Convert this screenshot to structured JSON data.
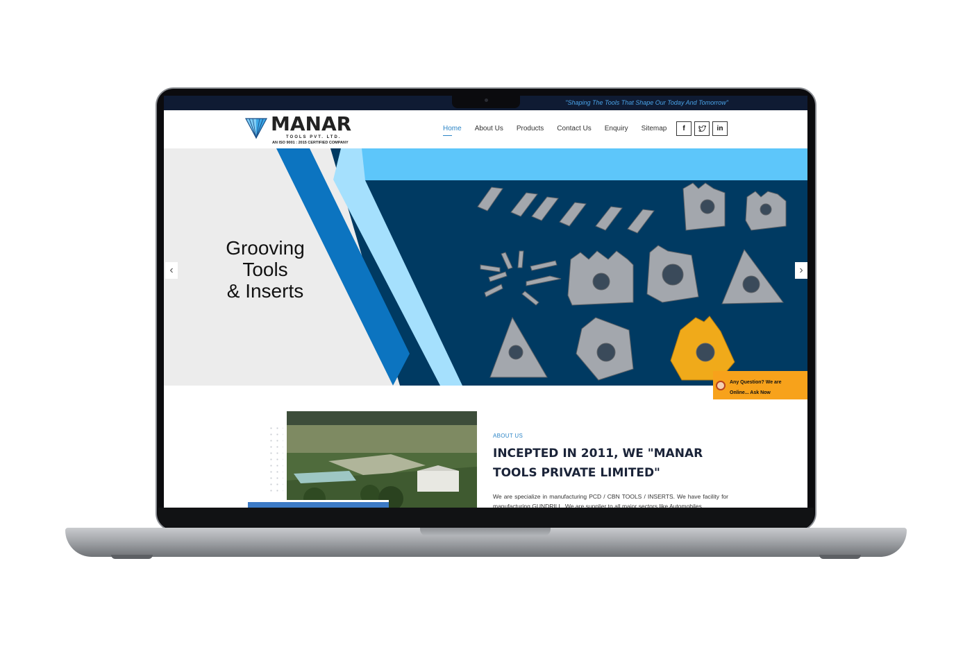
{
  "topbar": {
    "tagline": "\"Shaping The Tools That Shape Our Today And Tomorrow\""
  },
  "logo": {
    "name": "MANAR",
    "subtitle": "TOOLS PVT. LTD.",
    "certification": "AN ISO 9001 : 2015 CERTIFIED COMPANY"
  },
  "nav": {
    "items": [
      {
        "label": "Home",
        "active": true
      },
      {
        "label": "About Us"
      },
      {
        "label": "Products"
      },
      {
        "label": "Contact Us"
      },
      {
        "label": "Enquiry"
      },
      {
        "label": "Sitemap"
      }
    ]
  },
  "social": {
    "facebook": "f",
    "twitter": "t",
    "linkedin": "in"
  },
  "hero": {
    "title_lines": [
      "Grooving",
      "Tools",
      "& Inserts"
    ],
    "prev": "‹",
    "next": "›"
  },
  "chat": {
    "line1": "Any Question? We are",
    "line2": "Online... Ask Now"
  },
  "about": {
    "kicker": "ABOUT US",
    "heading": "INCEPTED IN 2011, WE \"MANAR TOOLS PRIVATE LIMITED\"",
    "text": "We are specialize in manufacturing PCD / CBN TOOLS / INSERTS. We have facility for manufacturing GUNDRILL. We are supplier to all major sectors like Automobiles,"
  },
  "colors": {
    "accent": "#2b84c6",
    "navy": "#0f1b33",
    "hero_dark": "#003a62",
    "hero_light": "#5dc6fa",
    "chat": "#f7a21b"
  }
}
